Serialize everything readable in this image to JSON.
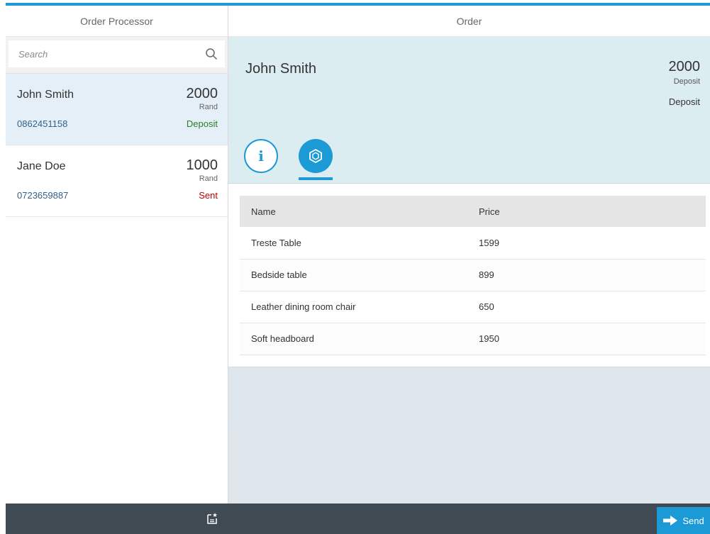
{
  "colors": {
    "accent": "#1c9ad6",
    "footer": "#3f4a52",
    "selected_bg": "#e4eff7",
    "status_deposit": "#2b7d2b",
    "status_sent": "#bb0000"
  },
  "master": {
    "title": "Order Processor",
    "search": {
      "placeholder": "Search",
      "icon": "search-icon"
    },
    "items": [
      {
        "name": "John Smith",
        "amount": "2000",
        "unit": "Rand",
        "phone": "0862451158",
        "status": "Deposit",
        "selected": true
      },
      {
        "name": "Jane Doe",
        "amount": "1000",
        "unit": "Rand",
        "phone": "0723659887",
        "status": "Sent",
        "selected": false
      }
    ],
    "footer": {
      "icon": "add-document-icon"
    }
  },
  "detail": {
    "title": "Order",
    "object": {
      "title": "John Smith",
      "number": "2000",
      "unit": "Deposit",
      "status": "Deposit"
    },
    "tabs": [
      {
        "icon": "info-icon",
        "glyph": "i",
        "selected": false
      },
      {
        "icon": "product-box-icon",
        "selected": true
      }
    ],
    "table": {
      "columns": [
        "Name",
        "Price"
      ],
      "rows": [
        {
          "name": "Treste Table",
          "price": "1599"
        },
        {
          "name": "Bedside table",
          "price": "899"
        },
        {
          "name": "Leather dining room chair",
          "price": "650"
        },
        {
          "name": "Soft headboard",
          "price": "1950"
        }
      ]
    },
    "footer": {
      "send_label": "Send",
      "send_icon": "arrow-right-icon"
    }
  }
}
